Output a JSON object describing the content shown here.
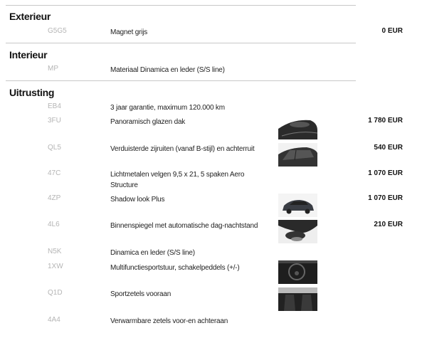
{
  "sections": [
    {
      "title": "Exterieur",
      "items": [
        {
          "code": "G5G5",
          "description": "Magnet grijs",
          "price": "0 EUR"
        }
      ]
    },
    {
      "title": "Interieur",
      "items": [
        {
          "code": "MP",
          "description": "Materiaal Dinamica en leder (S/S line)"
        }
      ]
    },
    {
      "title": "Uitrusting",
      "items": [
        {
          "code": "EB4",
          "description": "3 jaar garantie, maximum 120.000 km"
        },
        {
          "code": "3FU",
          "description": "Panoramisch glazen dak",
          "price": "1 780 EUR",
          "image": "panoramic-roof-photo"
        },
        {
          "code": "QL5",
          "description": "Verduisterde zijruiten (vanaf B-stijl) en achterruit",
          "price": "540 EUR",
          "image": "tinted-windows-photo"
        },
        {
          "code": "47C",
          "description": "Lichtmetalen velgen 9,5 x 21, 5 spaken Aero Structure",
          "price": "1 070 EUR"
        },
        {
          "code": "4ZP",
          "description": "Shadow look Plus",
          "price": "1 070 EUR",
          "image": "car-exterior-photo"
        },
        {
          "code": "4L6",
          "description": "Binnenspiegel met automatische dag-nachtstand",
          "price": "210 EUR",
          "image": "mirror-photo"
        },
        {
          "code": "N5K",
          "description": "Dinamica en leder (S/S line)"
        },
        {
          "code": "1XW",
          "description": "Multifunctiesportstuur, schakelpeddels (+/-)",
          "image": "steering-wheel-photo"
        },
        {
          "code": "Q1D",
          "description": "Sportzetels vooraan",
          "image": "sport-seats-photo"
        },
        {
          "code": "4A4",
          "description": "Verwarmbare zetels voor-en achteraan"
        }
      ]
    }
  ]
}
